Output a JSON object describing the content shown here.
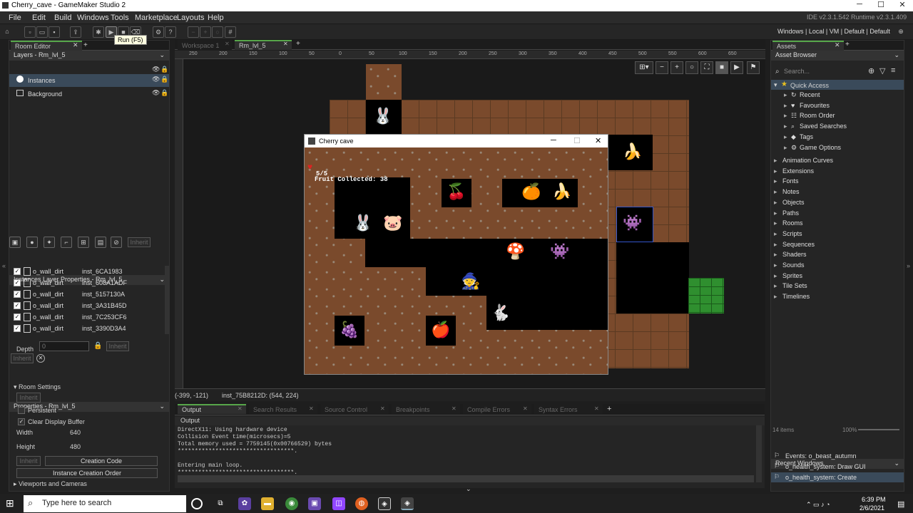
{
  "window": {
    "title": "Cherry_cave - GameMaker Studio 2"
  },
  "menu": [
    "File",
    "Edit",
    "Build",
    "Windows",
    "Tools",
    "Marketplace",
    "Layouts",
    "Help"
  ],
  "menu_right": "IDE v2.3.1.542  Runtime v2.3.1.409",
  "toolbar": {
    "tooltip": "Run (F5)",
    "targets": "Windows | Local | VM | Default | Default"
  },
  "room_editor": {
    "tab": "Room Editor",
    "layers_header": "Layers - Rm_lvl_5",
    "layers": [
      "Instances",
      "Background"
    ],
    "inherit": "Inherit",
    "instances_header": "Instances Layer Properties - Rm_lvl_5",
    "instances": [
      {
        "object": "o_wall_dirt",
        "id": "inst_6CA1983"
      },
      {
        "object": "o_wall_dirt",
        "id": "inst_608A1ADF"
      },
      {
        "object": "o_wall_dirt",
        "id": "inst_5157130A"
      },
      {
        "object": "o_wall_dirt",
        "id": "inst_3A31B45D"
      },
      {
        "object": "o_wall_dirt",
        "id": "inst_7C253CF6"
      },
      {
        "object": "o_wall_dirt",
        "id": "inst_3390D3A4"
      }
    ],
    "depth_label": "Depth",
    "depth_value": "0",
    "props_header": "Properties - Rm_lvl_5",
    "room_settings": "Room Settings",
    "persistent": "Persistent",
    "clear_display": "Clear Display Buffer",
    "width_label": "Width",
    "width": "640",
    "height_label": "Height",
    "height": "480",
    "creation_code": "Creation Code",
    "instance_order": "Instance Creation Order",
    "viewports": "Viewports and Cameras"
  },
  "workspace": {
    "tabs": [
      "Workspace 1",
      "Rm_lvl_5"
    ],
    "ruler": [
      "250",
      "200",
      "150",
      "100",
      "50",
      "0",
      "50",
      "100",
      "150",
      "200",
      "250",
      "300",
      "350",
      "400",
      "450",
      "500",
      "550",
      "600",
      "650"
    ],
    "status_coords": "(-399, -121)",
    "status_inst": "inst_75B8212D: (544, 224)"
  },
  "game": {
    "title": "Cherry cave",
    "health": "5/5",
    "fruit": "Fruit Collected: 38"
  },
  "output": {
    "tabs": [
      "Output",
      "Search Results",
      "Source Control",
      "Breakpoints",
      "Compile Errors",
      "Syntax Errors"
    ],
    "header": "Output",
    "lines": "DirectX11: Using hardware device\nCollision Event time(microsecs)=5\nTotal memory used = 7759145(0x00766529) bytes\n**********************************.\n\nEntering main loop.\n**********************************."
  },
  "assets": {
    "tab": "Assets",
    "browser": "Asset Browser",
    "search_placeholder": "Search...",
    "quick_access": "Quick Access",
    "quick": [
      "Recent",
      "Favourites",
      "Room Order",
      "Saved Searches",
      "Tags",
      "Game Options"
    ],
    "groups": [
      "Animation Curves",
      "Extensions",
      "Fonts",
      "Notes",
      "Objects",
      "Paths",
      "Rooms",
      "Scripts",
      "Sequences",
      "Shaders",
      "Sounds",
      "Sprites",
      "Tile Sets",
      "Timelines"
    ],
    "count": "14 items",
    "zoom": "100%",
    "recent_header": "Recent Windows",
    "recent": [
      "Events: o_beast_autumn",
      "o_health_system: Draw GUI",
      "o_health_system: Create"
    ]
  },
  "taskbar": {
    "search": "Type here to search",
    "time": "6:39 PM",
    "date": "2/6/2021"
  }
}
